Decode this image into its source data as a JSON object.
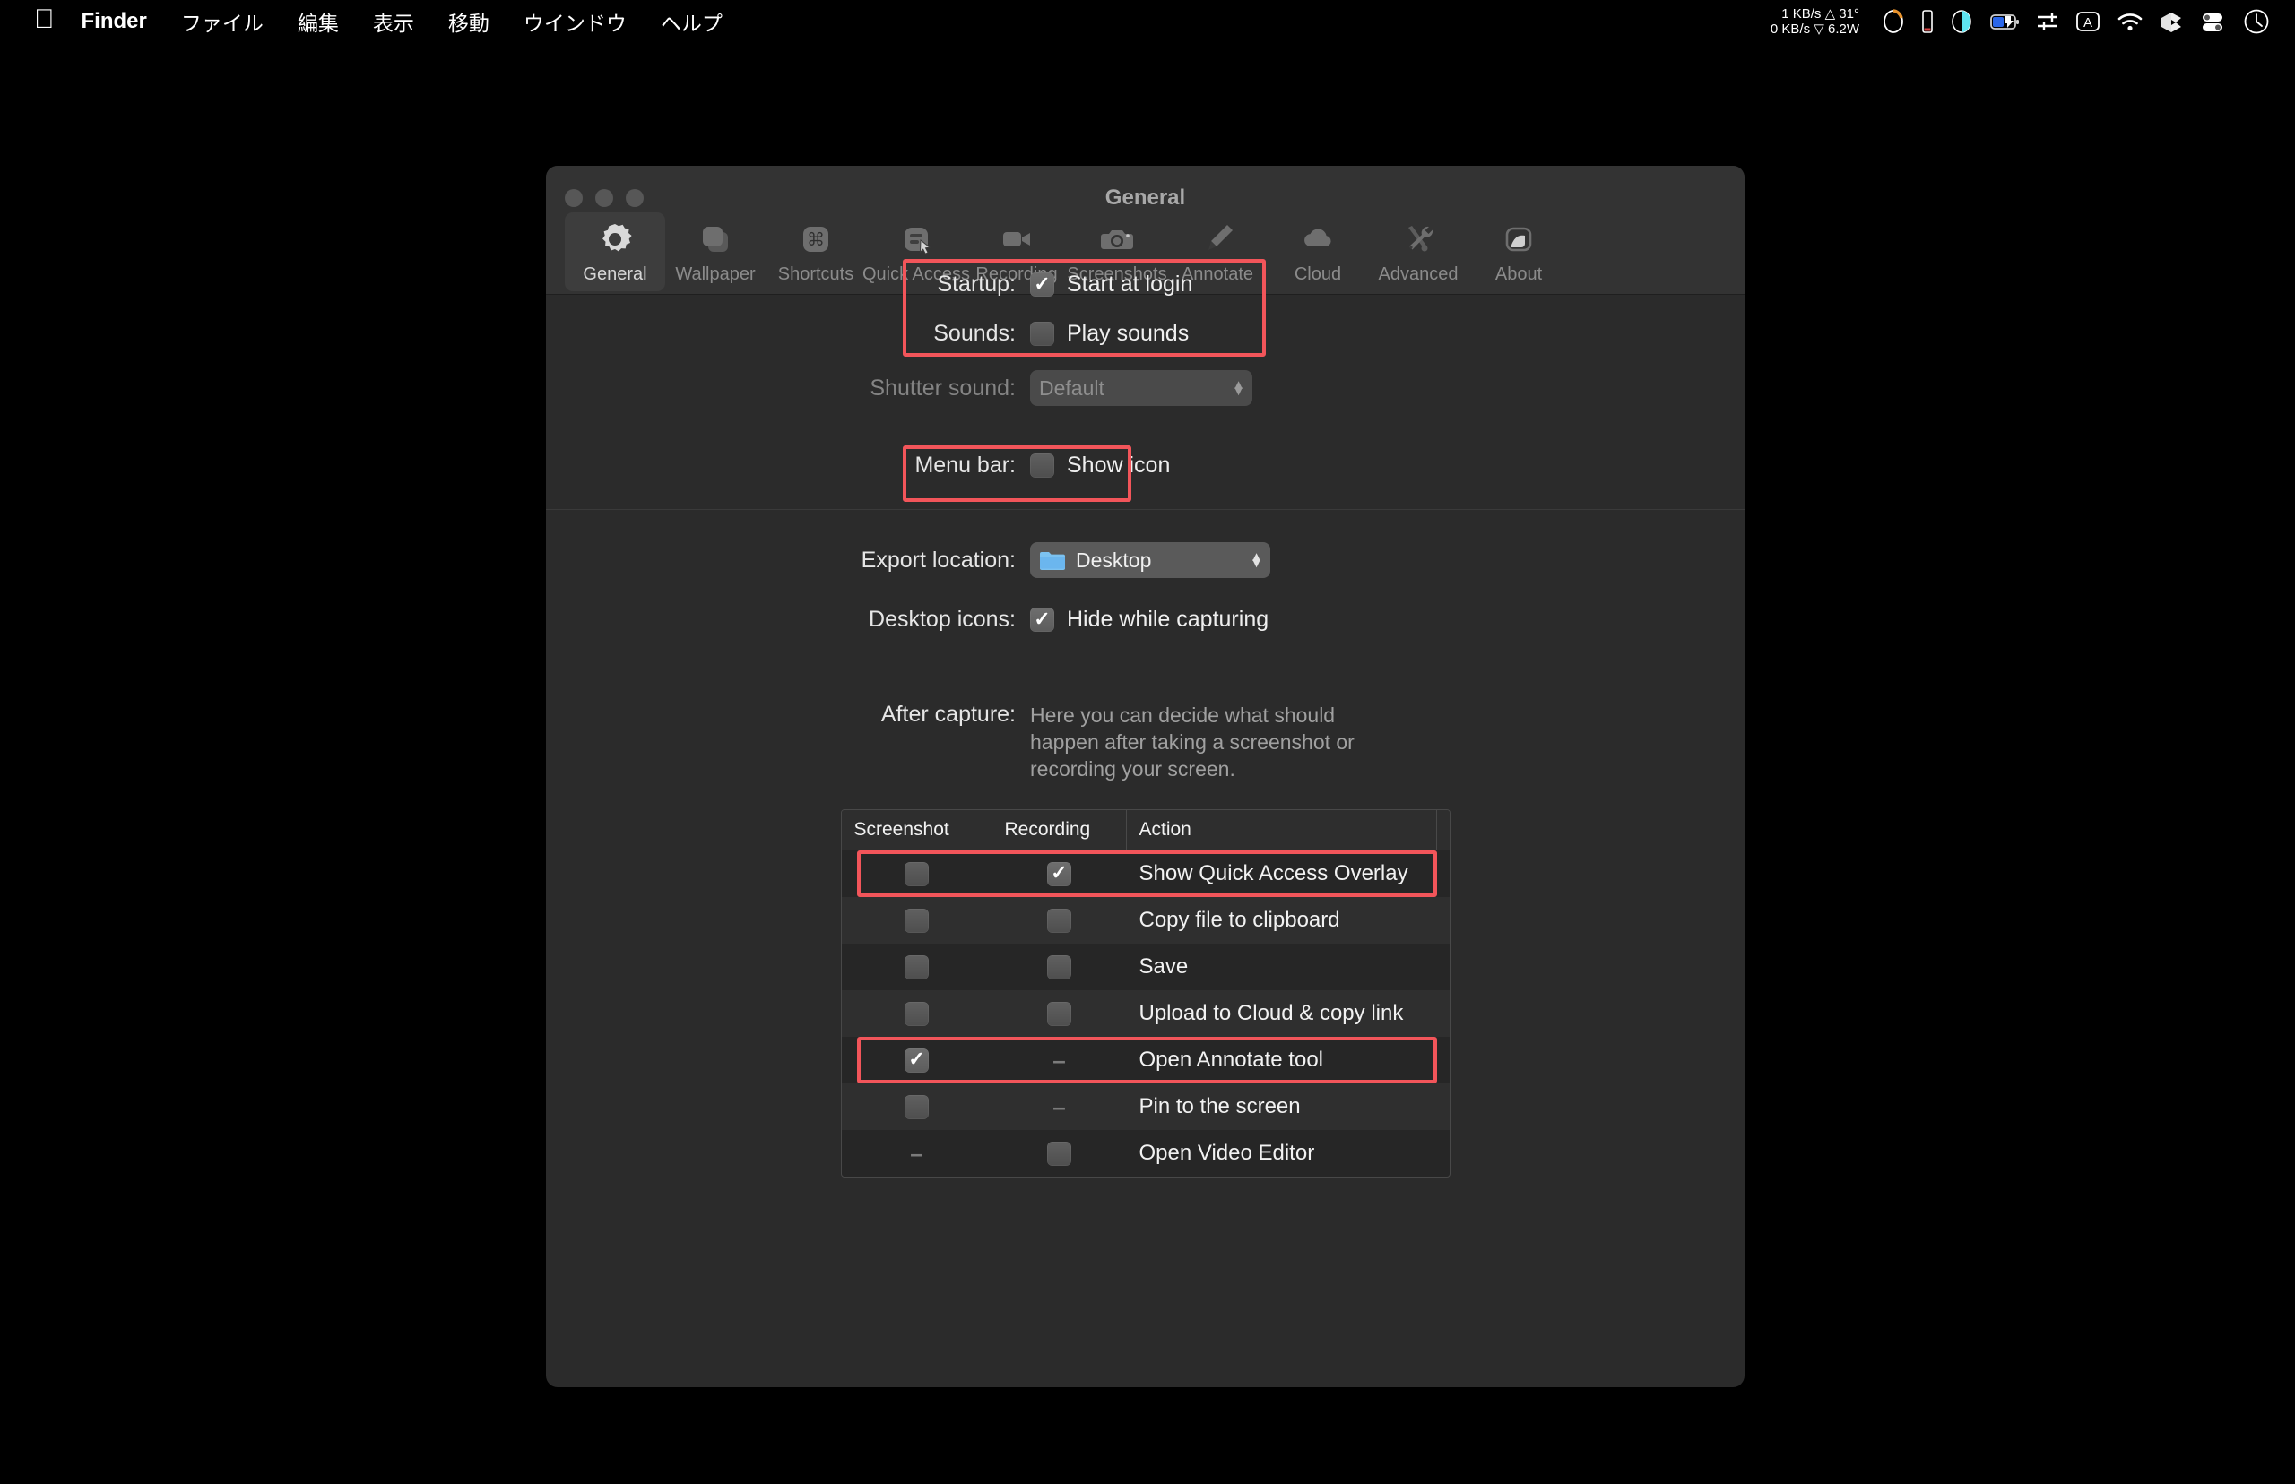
{
  "menubar": {
    "apple_icon": "apple-logo",
    "app_name": "Finder",
    "items": [
      "ファイル",
      "編集",
      "表示",
      "移動",
      "ウインドウ",
      "ヘルプ"
    ],
    "stats_line1": "1 KB/s △ 31°",
    "stats_line2": "0 KB/s ▽ 6.2W",
    "icons": [
      "disk-usage-gauge",
      "memory-bar",
      "battery-circle",
      "battery-charging",
      "sliders",
      "input-source-A",
      "wifi",
      "dropbox",
      "control-center-toggles",
      "clock"
    ]
  },
  "window": {
    "title": "General",
    "traffic_lights": [
      "close",
      "minimize",
      "zoom"
    ]
  },
  "toolbar": {
    "items": [
      {
        "label": "General",
        "icon": "gear-icon",
        "active": true
      },
      {
        "label": "Wallpaper",
        "icon": "wallpaper-icon",
        "active": false
      },
      {
        "label": "Shortcuts",
        "icon": "command-key-icon",
        "active": false
      },
      {
        "label": "Quick Access",
        "icon": "quick-access-icon",
        "active": false
      },
      {
        "label": "Recording",
        "icon": "video-camera-icon",
        "active": false
      },
      {
        "label": "Screenshots",
        "icon": "camera-icon",
        "active": false
      },
      {
        "label": "Annotate",
        "icon": "marker-pen-icon",
        "active": false
      },
      {
        "label": "Cloud",
        "icon": "cloud-icon",
        "active": false
      },
      {
        "label": "Advanced",
        "icon": "tools-icon",
        "active": false
      },
      {
        "label": "About",
        "icon": "about-icon",
        "active": false
      }
    ]
  },
  "general": {
    "startup_label": "Startup:",
    "start_at_login_label": "Start at login",
    "start_at_login_checked": true,
    "sounds_label": "Sounds:",
    "play_sounds_label": "Play sounds",
    "play_sounds_checked": false,
    "shutter_sound_label": "Shutter sound:",
    "shutter_sound_value": "Default",
    "shutter_sound_disabled": true,
    "menu_bar_label": "Menu bar:",
    "show_icon_label": "Show icon",
    "show_icon_checked": false,
    "export_location_label": "Export location:",
    "export_location_value": "Desktop",
    "export_location_icon": "blue-folder-icon",
    "desktop_icons_label": "Desktop icons:",
    "hide_while_capturing_label": "Hide while capturing",
    "hide_while_capturing_checked": true,
    "after_capture_label": "After capture:",
    "after_capture_description": "Here you can decide what should happen after taking a screenshot or recording your screen."
  },
  "after_capture_table": {
    "columns": [
      "Screenshot",
      "Recording",
      "Action"
    ],
    "rows": [
      {
        "action": "Show Quick Access Overlay",
        "screenshot": "unchecked",
        "recording": "checked",
        "highlighted": true
      },
      {
        "action": "Copy file to clipboard",
        "screenshot": "unchecked",
        "recording": "unchecked",
        "highlighted": false
      },
      {
        "action": "Save",
        "screenshot": "unchecked",
        "recording": "unchecked",
        "highlighted": false
      },
      {
        "action": "Upload to Cloud & copy link",
        "screenshot": "unchecked",
        "recording": "unchecked",
        "highlighted": false
      },
      {
        "action": "Open Annotate tool",
        "screenshot": "checked",
        "recording": "na",
        "highlighted": true
      },
      {
        "action": "Pin to the screen",
        "screenshot": "unchecked",
        "recording": "na",
        "highlighted": false
      },
      {
        "action": "Open Video Editor",
        "screenshot": "na",
        "recording": "unchecked",
        "highlighted": false
      }
    ]
  },
  "annotations": {
    "color": "#f2555a",
    "boxes": [
      "startup-sounds-group",
      "menu-bar-group",
      "quick-access-overlay-row",
      "open-annotate-tool-row"
    ]
  }
}
